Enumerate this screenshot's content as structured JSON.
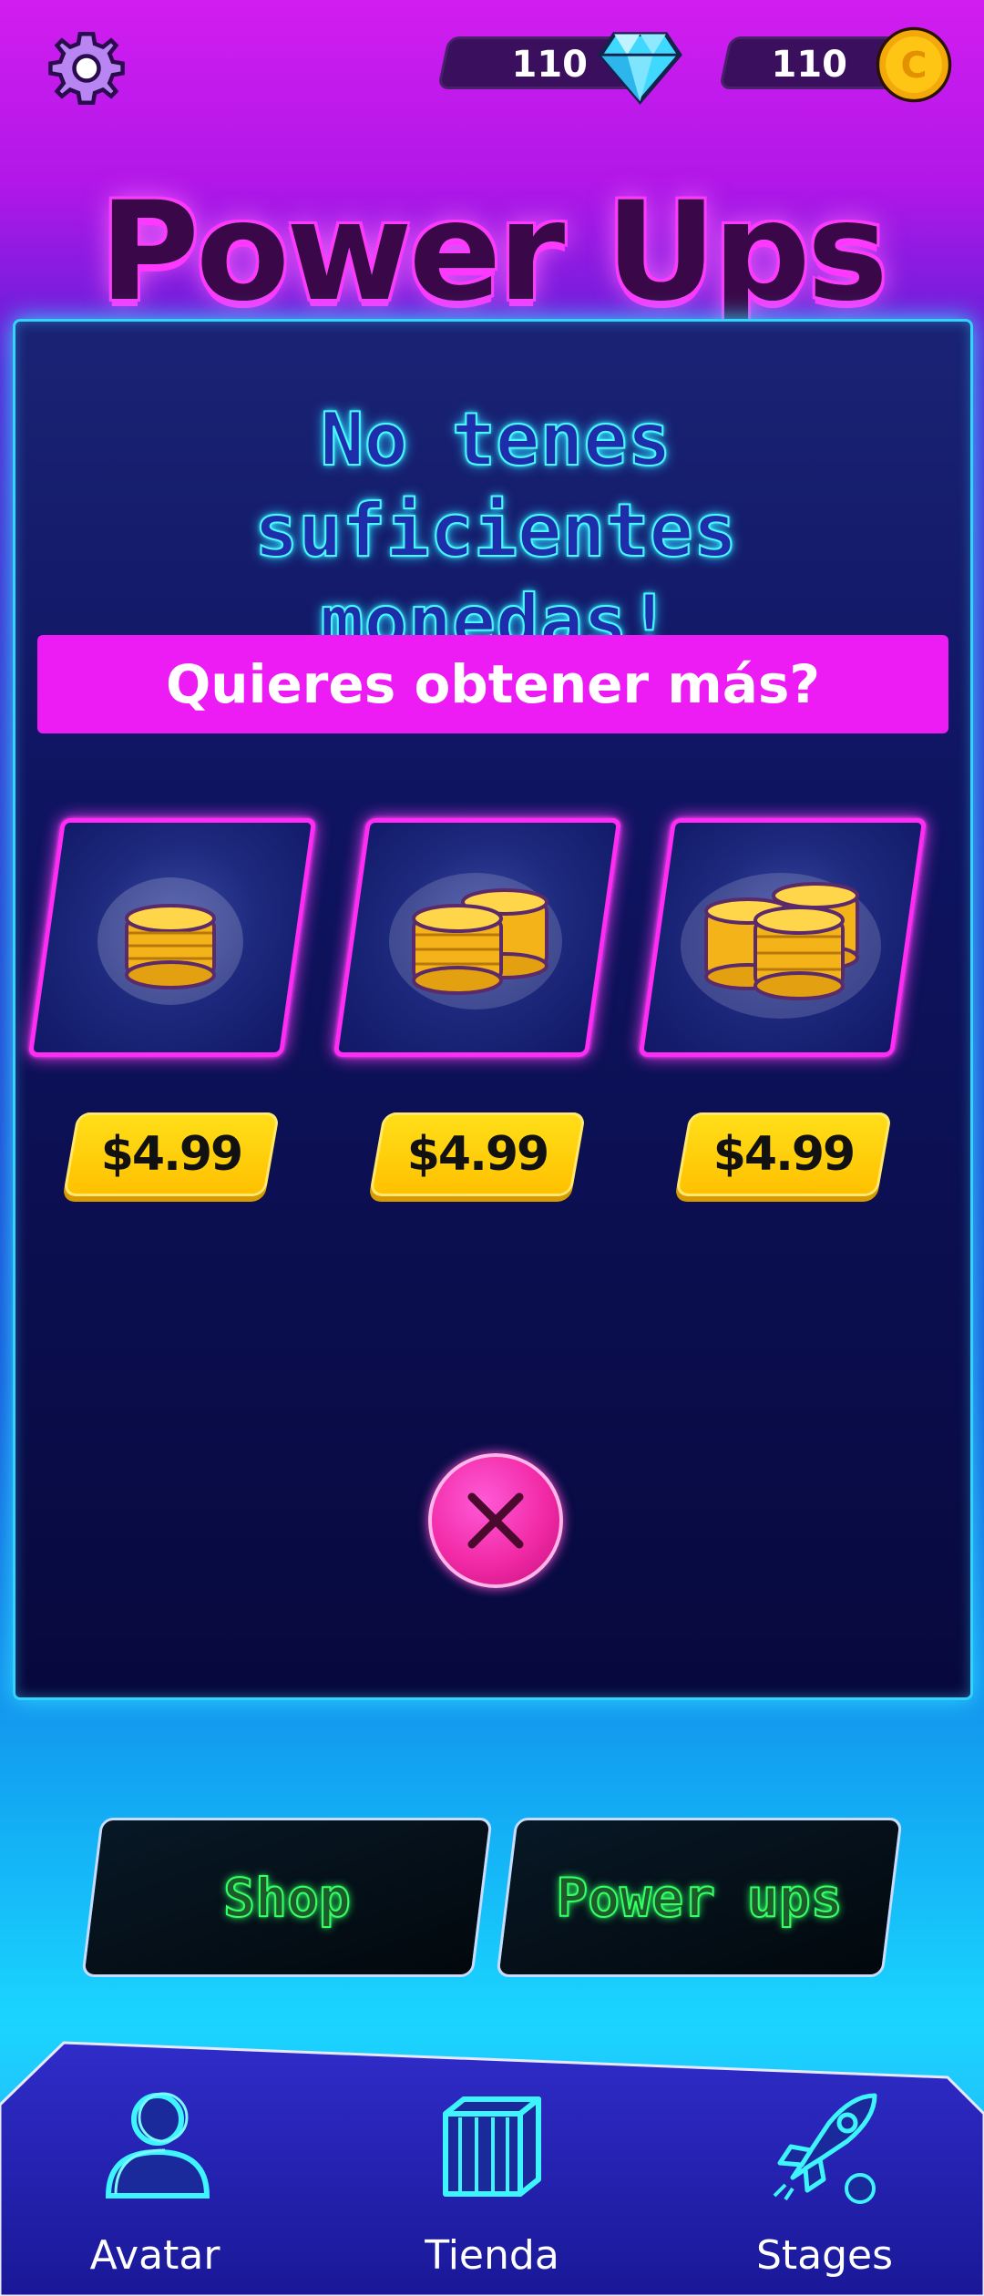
{
  "header": {
    "gems": "110",
    "coins": "110",
    "icons": {
      "settings": "gear-icon",
      "gems": "diamond-icon",
      "coins": "coin-icon"
    }
  },
  "title": "Power Ups",
  "panel": {
    "heading": "No tenes suficientes monedas!",
    "banner": "Quieres obtener más?",
    "offers": [
      {
        "price": "$4.99",
        "icon": "coin-stack-small-icon"
      },
      {
        "price": "$4.99",
        "icon": "coin-stack-medium-icon"
      },
      {
        "price": "$4.99",
        "icon": "coin-stack-large-icon"
      }
    ],
    "close_icon": "close-icon"
  },
  "actions": {
    "shop_label": "Shop",
    "powerups_label": "Power ups"
  },
  "bottom_nav": {
    "items": [
      {
        "label": "Avatar",
        "icon": "avatar-icon"
      },
      {
        "label": "Tienda",
        "icon": "store-icon"
      },
      {
        "label": "Stages",
        "icon": "rocket-icon"
      }
    ]
  },
  "colors": {
    "accent_pink": "#ee1cf4",
    "neon_cyan": "#33d3ff",
    "price_yellow": "#ffc000",
    "neon_green": "#36ff66"
  }
}
